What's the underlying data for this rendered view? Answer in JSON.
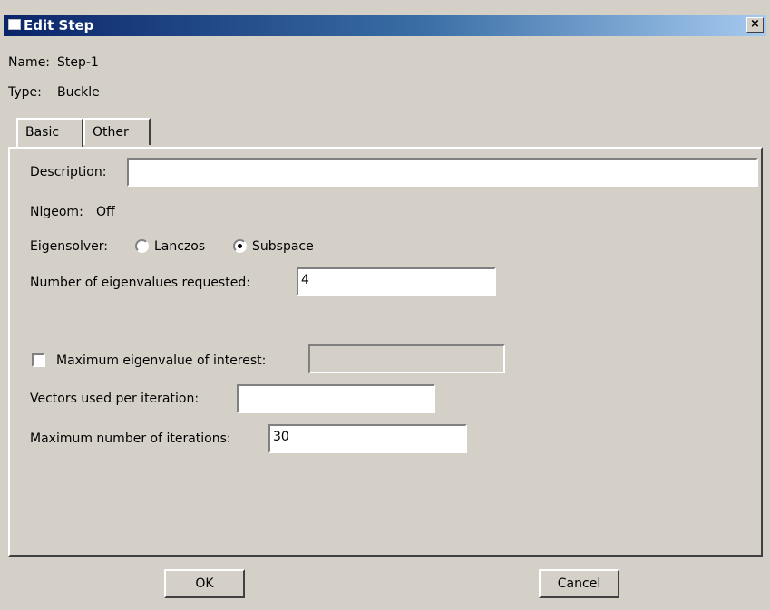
{
  "window": {
    "title": "Edit Step",
    "close_label": "×"
  },
  "step": {
    "name_label": "Name:",
    "name_value": "Step-1",
    "type_label": "Type:",
    "type_value": "Buckle"
  },
  "tabs": [
    {
      "label": "Basic"
    },
    {
      "label": "Other"
    }
  ],
  "basic": {
    "description_label": "Description:",
    "description_value": "",
    "nlgeom_label": "Nlgeom:",
    "nlgeom_value": "Off",
    "eigensolver_label": "Eigensolver:",
    "eigensolver_options": [
      {
        "label": "Lanczos",
        "selected": false
      },
      {
        "label": "Subspace",
        "selected": true
      }
    ],
    "num_eigenvalues_label": "Number of eigenvalues requested:",
    "num_eigenvalues_value": "4",
    "max_eigenvalue_label": "Maximum eigenvalue of interest:",
    "max_eigenvalue_checked": false,
    "max_eigenvalue_value": "",
    "vectors_label": "Vectors used per iteration:",
    "vectors_value": "",
    "max_iterations_label": "Maximum number of iterations:",
    "max_iterations_value": "30"
  },
  "buttons": {
    "ok": "OK",
    "cancel": "Cancel"
  }
}
